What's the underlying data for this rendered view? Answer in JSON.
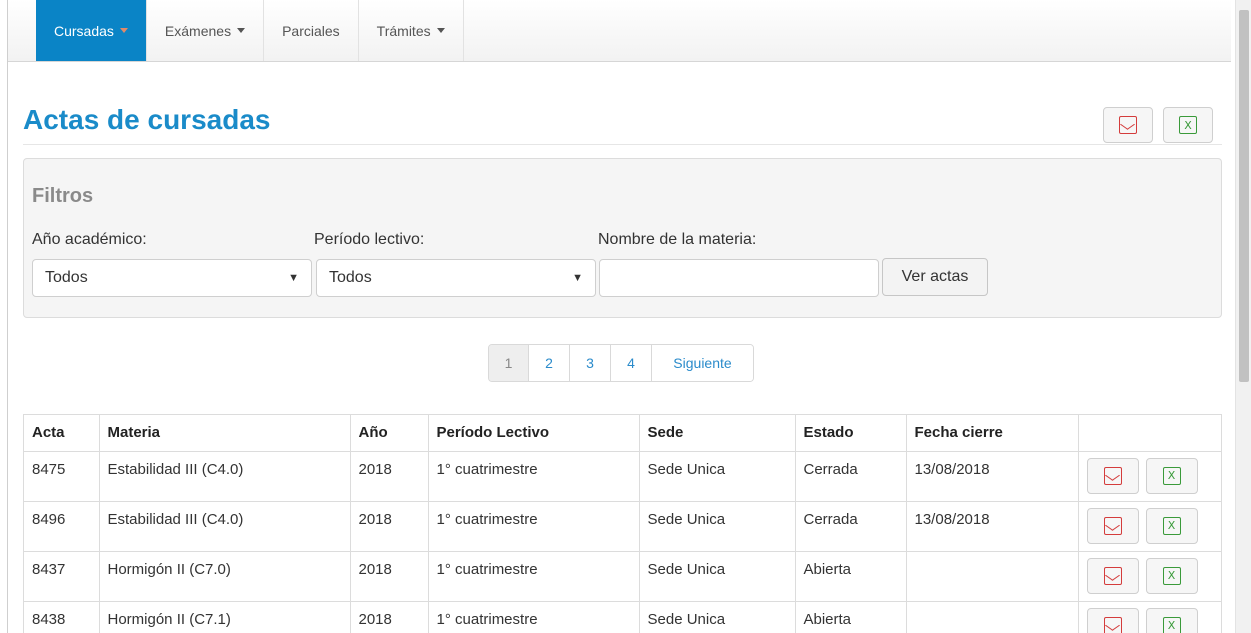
{
  "nav": {
    "items": [
      {
        "label": "Cursadas",
        "active": true,
        "dropdown": true
      },
      {
        "label": "Exámenes",
        "active": false,
        "dropdown": true
      },
      {
        "label": "Parciales",
        "active": false,
        "dropdown": false
      },
      {
        "label": "Trámites",
        "active": false,
        "dropdown": true
      }
    ]
  },
  "page": {
    "title": "Actas de cursadas",
    "export_pdf_icon": "pdf-icon",
    "export_xls_icon": "excel-icon"
  },
  "filters": {
    "title": "Filtros",
    "anio_label": "Año académico:",
    "anio_value": "Todos",
    "periodo_label": "Período lectivo:",
    "periodo_value": "Todos",
    "materia_label": "Nombre de la materia:",
    "materia_value": "",
    "submit_label": "Ver actas"
  },
  "pagination": {
    "pages": [
      "1",
      "2",
      "3",
      "4"
    ],
    "current": "1",
    "next_label": "Siguiente"
  },
  "table": {
    "headers": [
      "Acta",
      "Materia",
      "Año",
      "Período Lectivo",
      "Sede",
      "Estado",
      "Fecha cierre"
    ],
    "rows": [
      {
        "acta": "8475",
        "materia": "Estabilidad III (C4.0)",
        "anio": "2018",
        "periodo": "1° cuatrimestre",
        "sede": "Sede Unica",
        "estado": "Cerrada",
        "fecha": "13/08/2018"
      },
      {
        "acta": "8496",
        "materia": "Estabilidad III (C4.0)",
        "anio": "2018",
        "periodo": "1° cuatrimestre",
        "sede": "Sede Unica",
        "estado": "Cerrada",
        "fecha": "13/08/2018"
      },
      {
        "acta": "8437",
        "materia": "Hormigón II (C7.0)",
        "anio": "2018",
        "periodo": "1° cuatrimestre",
        "sede": "Sede Unica",
        "estado": "Abierta",
        "fecha": ""
      },
      {
        "acta": "8438",
        "materia": "Hormigón II (C7.1)",
        "anio": "2018",
        "periodo": "1° cuatrimestre",
        "sede": "Sede Unica",
        "estado": "Abierta",
        "fecha": ""
      }
    ]
  },
  "colors": {
    "accent": "#0a84c6",
    "title": "#1a8bc9",
    "pdf": "#d43c3c",
    "excel": "#3a9a3a"
  }
}
